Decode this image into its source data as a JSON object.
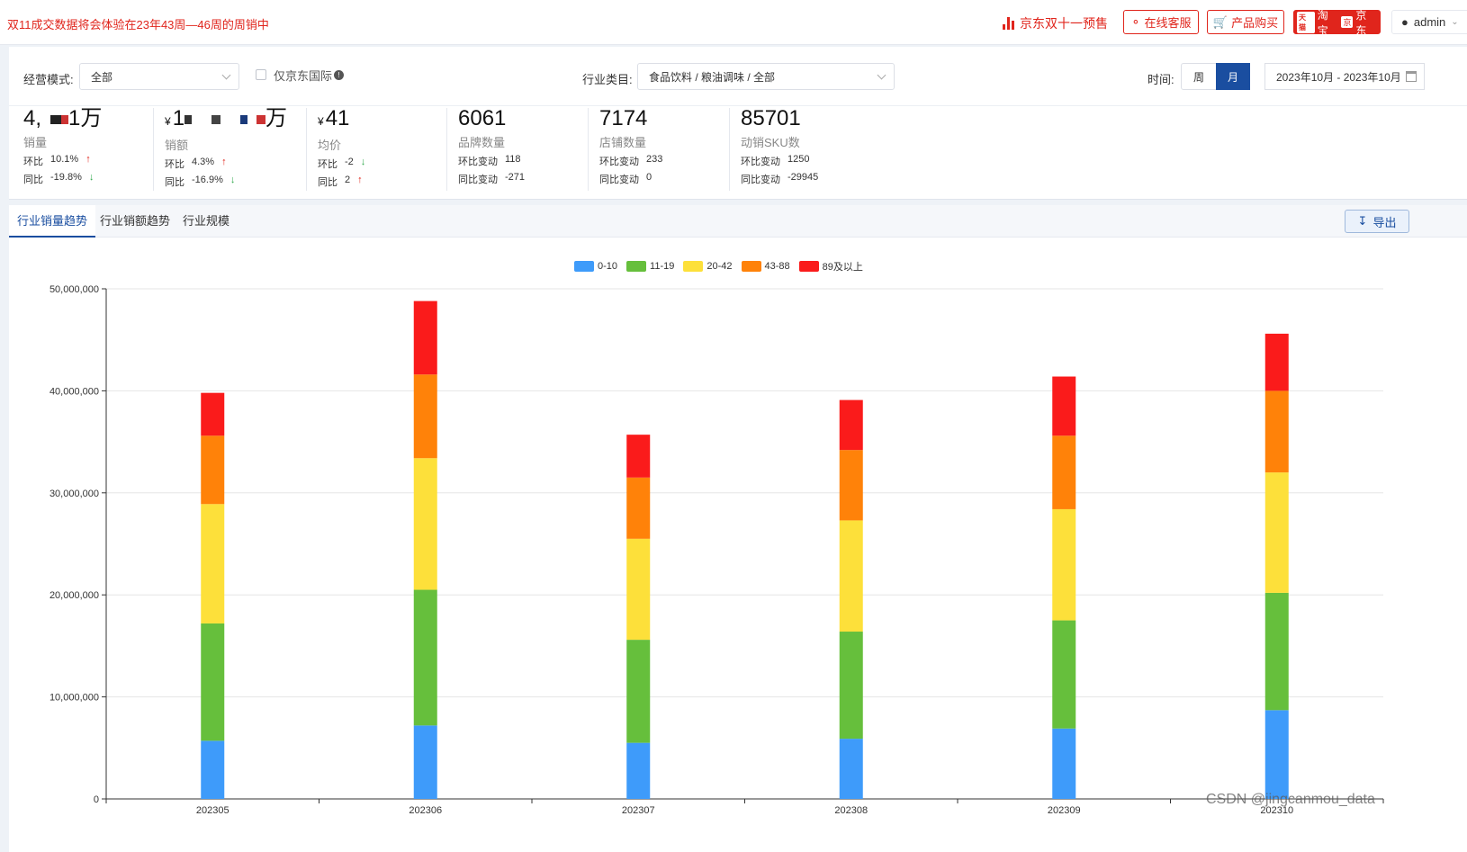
{
  "topbar": {
    "notice": "双11成交数据将会体验在23年43周—46周的周销中",
    "promo": "京东双十一预售",
    "service_label": "在线客服",
    "purchase_label": "产品购买",
    "platform_tmall": "天猫",
    "platform_taobao": "淘宝",
    "platform_jd_icon": "京",
    "platform_jd": "京东",
    "user": "admin"
  },
  "filters": {
    "mode_label": "经营模式:",
    "mode_value": "全部",
    "jd_intl_label": "仅京东国际",
    "industry_label": "行业类目:",
    "industry_value": "食品饮料 / 粮油调味 / 全部",
    "time_label": "时间:",
    "time_week": "周",
    "time_month": "月",
    "date_range": "2023年10月 - 2023年10月"
  },
  "kpis": [
    {
      "value_a": "4,",
      "value_b": "1万",
      "currency": "",
      "label": "销量",
      "r1_label": "环比",
      "r1_value": "10.1%",
      "r1_dir": "up",
      "r2_label": "同比",
      "r2_value": "-19.8%",
      "r2_dir": "down"
    },
    {
      "value_a": "1",
      "value_b": "万",
      "currency": "¥",
      "label": "销额",
      "r1_label": "环比",
      "r1_value": "4.3%",
      "r1_dir": "up",
      "r2_label": "同比",
      "r2_value": "-16.9%",
      "r2_dir": "down"
    },
    {
      "value_a": "41",
      "value_b": "",
      "currency": "¥",
      "label": "均价",
      "r1_label": "环比",
      "r1_value": "-2",
      "r1_dir": "down",
      "r2_label": "同比",
      "r2_value": "2",
      "r2_dir": "up"
    },
    {
      "value_a": "6061",
      "value_b": "",
      "currency": "",
      "label": "品牌数量",
      "r1_label": "环比变动",
      "r1_value": "118",
      "r1_dir": "",
      "r2_label": "同比变动",
      "r2_value": "-271",
      "r2_dir": ""
    },
    {
      "value_a": "7174",
      "value_b": "",
      "currency": "",
      "label": "店铺数量",
      "r1_label": "环比变动",
      "r1_value": "233",
      "r1_dir": "",
      "r2_label": "同比变动",
      "r2_value": "0",
      "r2_dir": ""
    },
    {
      "value_a": "85701",
      "value_b": "",
      "currency": "",
      "label": "动销SKU数",
      "r1_label": "环比变动",
      "r1_value": "1250",
      "r1_dir": "",
      "r2_label": "同比变动",
      "r2_value": "-29945",
      "r2_dir": ""
    }
  ],
  "tabs": [
    "行业销量趋势",
    "行业销额趋势",
    "行业规模"
  ],
  "export_label": "导出",
  "watermark": "CSDN @jingcanmou_data",
  "chart_data": {
    "type": "bar",
    "stacked": true,
    "categories": [
      "202305",
      "202306",
      "202307",
      "202308",
      "202309",
      "202310"
    ],
    "series": [
      {
        "name": "0-10",
        "color": "#3e9bfa",
        "values": [
          5700000,
          7200000,
          5500000,
          5900000,
          6900000,
          8700000
        ]
      },
      {
        "name": "11-19",
        "color": "#66bf3c",
        "values": [
          11500000,
          13300000,
          10100000,
          10500000,
          10600000,
          11500000
        ]
      },
      {
        "name": "20-42",
        "color": "#fde03a",
        "values": [
          11700000,
          12900000,
          9900000,
          10900000,
          10900000,
          11800000
        ]
      },
      {
        "name": "43-88",
        "color": "#ff8209",
        "values": [
          6700000,
          8200000,
          6000000,
          6900000,
          7200000,
          8000000
        ]
      },
      {
        "name": "89及以上",
        "color": "#fa1b1b",
        "values": [
          4200000,
          7200000,
          4200000,
          4900000,
          5800000,
          5600000
        ]
      }
    ],
    "ylim": [
      0,
      50000000
    ],
    "yticks": [
      "0",
      "10,000,000",
      "20,000,000",
      "30,000,000",
      "40,000,000",
      "50,000,000"
    ],
    "legend_position": "top-center",
    "grid": true
  }
}
